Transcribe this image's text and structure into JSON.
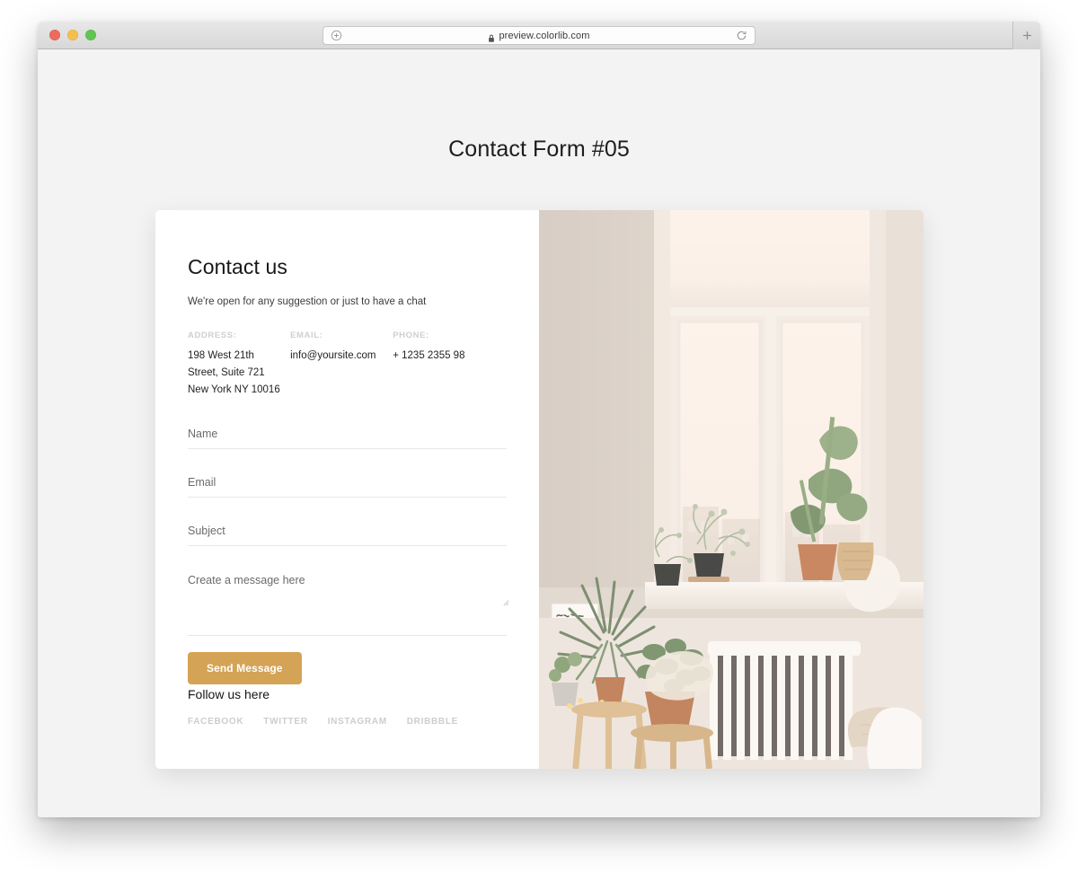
{
  "browser": {
    "traffic_lights": [
      "close",
      "minimize",
      "zoom"
    ],
    "url": "preview.colorlib.com",
    "url_left_icon": "add-circle-icon",
    "reload_icon": "reload-icon",
    "lock_icon": "lock-icon",
    "newtab_label": "+"
  },
  "page": {
    "title": "Contact Form #05",
    "background_color": "#f3f3f3"
  },
  "form": {
    "heading": "Contact us",
    "subtitle": "We're open for any suggestion or just to have a chat",
    "details": [
      {
        "label": "ADDRESS:",
        "value": "198 West 21th\nStreet, Suite 721\nNew York NY 10016"
      },
      {
        "label": "EMAIL:",
        "value": "info@yoursite.com"
      },
      {
        "label": "PHONE:",
        "value": "+ 1235 2355 98"
      }
    ],
    "fields": [
      {
        "name": "name",
        "placeholder": "Name",
        "value": ""
      },
      {
        "name": "email",
        "placeholder": "Email",
        "value": ""
      },
      {
        "name": "subject",
        "placeholder": "Subject",
        "value": ""
      },
      {
        "name": "message",
        "placeholder": "Create a message here",
        "value": ""
      }
    ],
    "submit_label": "Send Message",
    "submit_color": "#d4a355"
  },
  "follow": {
    "heading": "Follow us here",
    "links": [
      "FACEBOOK",
      "TWITTER",
      "INSTAGRAM",
      "DRIBBBLE"
    ]
  },
  "photo": {
    "description": "Bright window with white frames, potted plants on windowsill, radiator below, cushions and wooden stools with plants",
    "poster_text": "Don't trust anybody who doesn't hav a sense of humour!"
  }
}
